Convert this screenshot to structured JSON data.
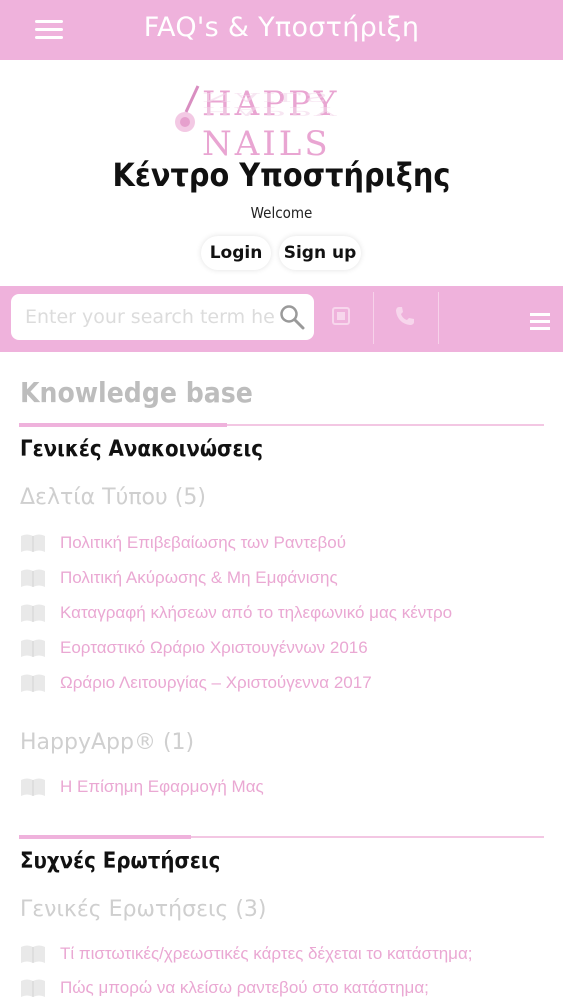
{
  "appbar": {
    "title": "FAQ's & Υποστήριξη"
  },
  "header": {
    "logo_text": "Happy NaiLs",
    "title": "Κέντρο Υποστήριξης",
    "welcome": "Welcome",
    "login_label": "Login",
    "signup_label": "Sign up"
  },
  "toolbar": {
    "search_placeholder": "Enter your search term here...",
    "search_value": ""
  },
  "content": {
    "kb_title": "Knowledge base",
    "sections": [
      {
        "title": "Γενικές Ανακοινώσεις",
        "categories": [
          {
            "name": "Δελτία Τύπου",
            "count": "(5)",
            "articles": [
              "Πολιτική Επιβεβαίωσης των Ραντεβού",
              "Πολιτική Ακύρωσης & Μη Εμφάνισης",
              "Καταγραφή κλήσεων από το τηλεφωνικό μας κέντρο",
              "Εορταστικό Ωράριο Χριστουγέννων 2016",
              "Ωράριο Λειτουργίας – Χριστούγεννα 2017"
            ]
          },
          {
            "name": "HappyApp®",
            "count": "(1)",
            "articles": [
              "Η Επίσημη Εφαρμογή Μας"
            ]
          }
        ]
      },
      {
        "title": "Συχνές Ερωτήσεις",
        "categories": [
          {
            "name": "Γενικές Ερωτήσεις",
            "count": "(3)",
            "articles": [
              "Τί πιστωτικές/χρεωστικές κάρτες δέχεται το κατάστημα;",
              "Πώς μπορώ να κλείσω ραντεβού στο κατάστημα;"
            ]
          }
        ]
      }
    ]
  },
  "colors": {
    "accent": "#efb2dc",
    "link": "#eaa8d3",
    "muted": "#cfcfcf"
  }
}
